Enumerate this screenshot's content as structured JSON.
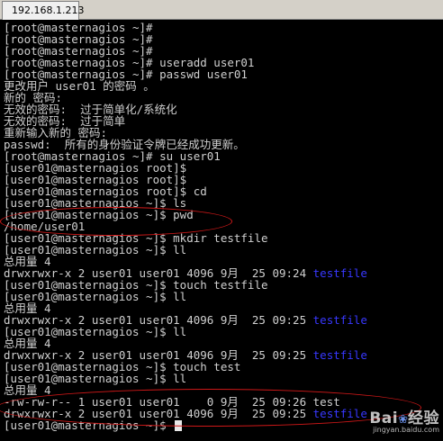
{
  "tab": {
    "title": "192.168.1.213"
  },
  "terminal": {
    "lines": [
      "[root@masternagios ~]#",
      "[root@masternagios ~]#",
      "[root@masternagios ~]#",
      "[root@masternagios ~]# useradd user01",
      "[root@masternagios ~]# passwd user01",
      "更改用户 user01 的密码 。",
      "新的 密码:",
      "无效的密码:  过于简单化/系统化",
      "无效的密码:  过于简单",
      "重新输入新的 密码:",
      "passwd:  所有的身份验证令牌已经成功更新。",
      "[root@masternagios ~]# su user01",
      "[user01@masternagios root]$",
      "[user01@masternagios root]$",
      "[user01@masternagios root]$ cd",
      "[user01@masternagios ~]$ ls",
      "[user01@masternagios ~]$ pwd",
      "/home/user01",
      "[user01@masternagios ~]$ mkdir testfile",
      "[user01@masternagios ~]$ ll",
      "总用量 4",
      {
        "text": "drwxrwxr-x 2 user01 user01 4096 9月  25 09:24 ",
        "name": "testfile"
      },
      "[user01@masternagios ~]$ touch testfile",
      "[user01@masternagios ~]$ ll",
      "总用量 4",
      {
        "text": "drwxrwxr-x 2 user01 user01 4096 9月  25 09:25 ",
        "name": "testfile"
      },
      "[user01@masternagios ~]$ ll",
      "总用量 4",
      {
        "text": "drwxrwxr-x 2 user01 user01 4096 9月  25 09:25 ",
        "name": "testfile"
      },
      "[user01@masternagios ~]$ touch test",
      "[user01@masternagios ~]$ ll",
      "总用量 4",
      "-rw-rw-r-- 1 user01 user01    0 9月  25 09:26 test",
      {
        "text": "drwxrwxr-x 2 user01 user01 4096 9月  25 09:25 ",
        "name": "testfile"
      },
      {
        "text": "[user01@masternagios ~]$ ",
        "cursor": true
      }
    ]
  },
  "watermark": {
    "logo": "Bai",
    "logo_tail": "经验",
    "url": "jingyan.baidu.com"
  },
  "colors": {
    "background": "#000000",
    "text": "#d0d0d0",
    "directory": "#3838ff",
    "annotation": "#d01818"
  }
}
